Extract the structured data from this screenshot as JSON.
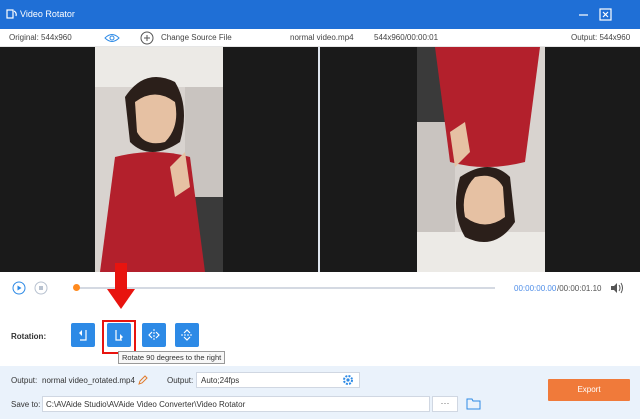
{
  "window": {
    "title": "Video Rotator"
  },
  "infobar": {
    "original": "Original: 544x960",
    "change_source": "Change Source File",
    "file_name": "normal video.mp4",
    "meta": "544x960/00:00:01",
    "output": "Output: 544x960"
  },
  "player": {
    "current_time": "00:00:00.00",
    "total_time": "/00:00:01.10",
    "progress": 0
  },
  "rotation": {
    "label": "Rotation:",
    "buttons": [
      {
        "icon": "rotate-left-icon"
      },
      {
        "icon": "rotate-right-icon",
        "selected": true
      },
      {
        "icon": "flip-horizontal-icon"
      },
      {
        "icon": "flip-vertical-icon"
      }
    ],
    "tooltip": "Rotate 90 degrees to the right"
  },
  "bottom": {
    "output_label": "Output:",
    "output_name": "normal video_rotated.mp4",
    "format_label": "Output:",
    "format_value": "Auto;24fps",
    "save_label": "Save to:",
    "save_path": "C:\\AVAide Studio\\AVAide Video Converter\\Video Rotator",
    "browse_label": "···",
    "export_label": "Export"
  },
  "colors": {
    "titlebar": "#1f6fd6",
    "accent": "#2d8ae6",
    "export": "#f07a3a",
    "highlight": "#e8140f"
  }
}
